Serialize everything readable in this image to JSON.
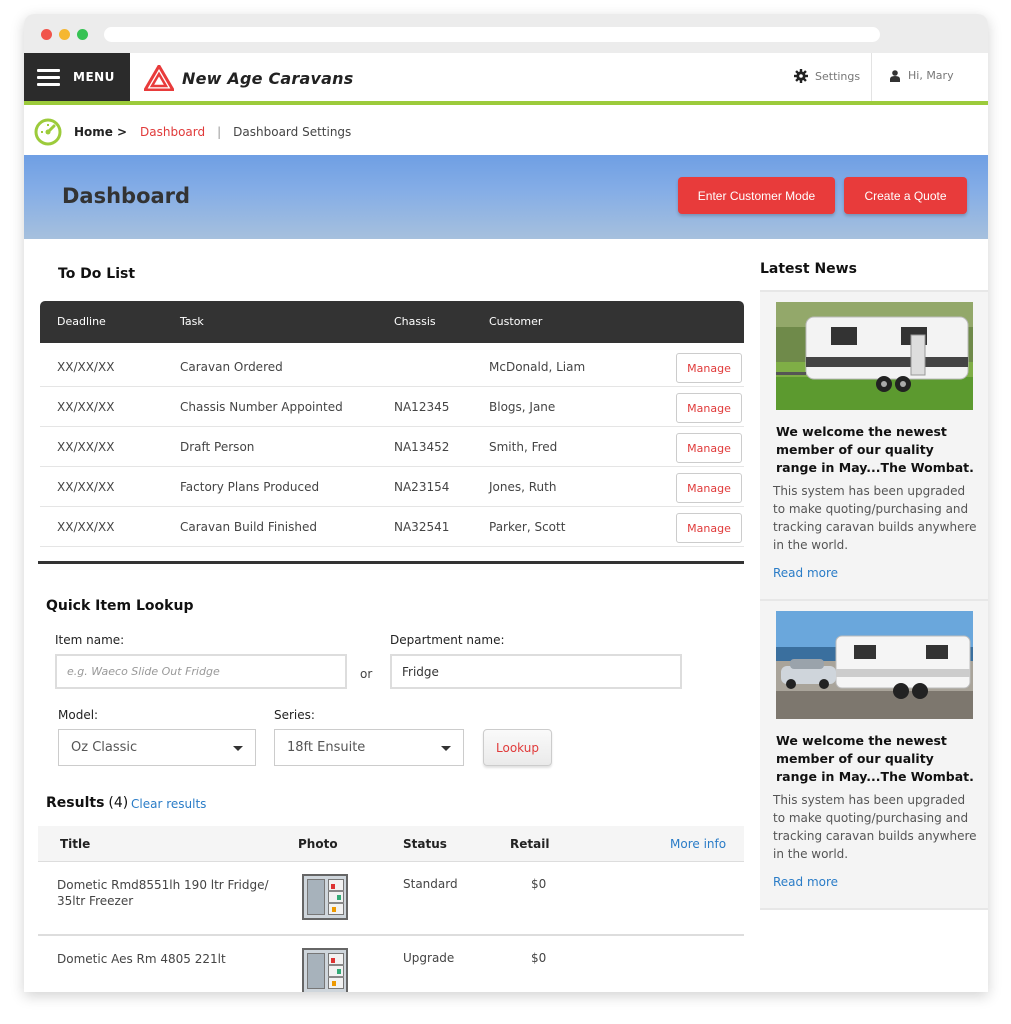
{
  "app": {
    "menu_label": "MENU",
    "brand_name": "New Age Caravans",
    "settings_label": "Settings",
    "user_greeting": "Hi, Mary",
    "accent_color": "#9ccb3b",
    "brand_red": "#e83b3b"
  },
  "breadcrumb": {
    "home": "Home",
    "chevron": ">",
    "dashboard": "Dashboard",
    "separator": "|",
    "current": "Dashboard Settings"
  },
  "hero": {
    "title": "Dashboard",
    "customer_mode_label": "Enter Customer Mode",
    "create_quote_label": "Create a Quote"
  },
  "todo": {
    "title": "To Do List",
    "columns": [
      "Deadline",
      "Task",
      "Chassis",
      "Customer"
    ],
    "rows": [
      {
        "deadline": "XX/XX/XX",
        "task": "Caravan Ordered",
        "chassis": "",
        "customer": "McDonald, Liam",
        "action": "Manage"
      },
      {
        "deadline": "XX/XX/XX",
        "task": "Chassis Number Appointed",
        "chassis": "NA12345",
        "customer": "Blogs, Jane",
        "action": "Manage"
      },
      {
        "deadline": "XX/XX/XX",
        "task": "Draft Person",
        "chassis": "NA13452",
        "customer": "Smith, Fred",
        "action": "Manage"
      },
      {
        "deadline": "XX/XX/XX",
        "task": "Factory Plans Produced",
        "chassis": "NA23154",
        "customer": "Jones, Ruth",
        "action": "Manage"
      },
      {
        "deadline": "XX/XX/XX",
        "task": "Caravan Build Finished",
        "chassis": "NA32541",
        "customer": "Parker, Scott",
        "action": "Manage"
      }
    ]
  },
  "lookup": {
    "title": "Quick Item Lookup",
    "item_label": "Item name:",
    "item_placeholder": "e.g. Waeco Slide Out Fridge",
    "or_label": "or",
    "department_label": "Department name:",
    "department_value": "Fridge",
    "model_label": "Model:",
    "model_value": "Oz Classic",
    "series_label": "Series:",
    "series_value": "18ft Ensuite",
    "lookup_button": "Lookup"
  },
  "results": {
    "title": "Results",
    "count": "(4)",
    "clear_label": "Clear results",
    "columns": {
      "title": "Title",
      "photo": "Photo",
      "status": "Status",
      "retail": "Retail",
      "more": "More info"
    },
    "rows": [
      {
        "title_line1": "Dometic Rmd8551lh 190 ltr Fridge/",
        "title_line2": "35ltr Freezer",
        "status": "Standard",
        "retail": "$0"
      },
      {
        "title_line1": "Dometic Aes Rm 4805 221lt",
        "title_line2": "",
        "status": "Upgrade",
        "retail": "$0"
      }
    ]
  },
  "news": {
    "title": "Latest News",
    "items": [
      {
        "heading": "We welcome the newest member of our quality range in May...The Wombat.",
        "body": "This system has been upgraded to make quoting/purchasing and tracking caravan builds anywhere in the world.",
        "read_more": "Read more"
      },
      {
        "heading": "We welcome the newest member of our quality range in May...The Wombat.",
        "body": "This system has been upgraded to make quoting/purchasing and tracking caravan builds anywhere in the world.",
        "read_more": "Read more"
      }
    ]
  }
}
